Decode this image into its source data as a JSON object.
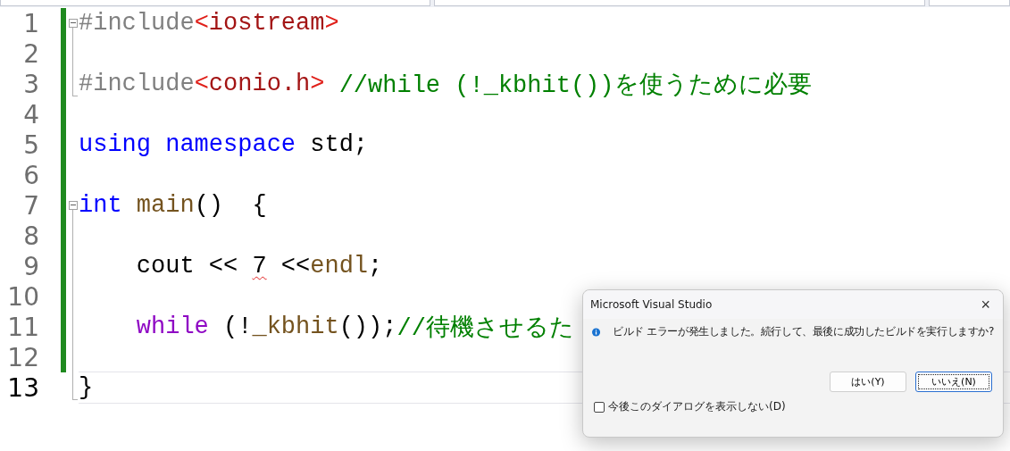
{
  "code_lines": [
    {
      "number": "1",
      "current": false,
      "changed": true,
      "kind": "foldstart",
      "tokens": [
        {
          "kind": "preproc",
          "text": "#include"
        },
        {
          "kind": "bracket",
          "text": "<"
        },
        {
          "kind": "string",
          "text": "iostream"
        },
        {
          "kind": "bracket",
          "text": ">"
        }
      ]
    },
    {
      "number": "2",
      "current": false,
      "changed": true,
      "kind": "foldline"
    },
    {
      "number": "3",
      "current": false,
      "changed": true,
      "kind": "foldend",
      "tokens": [
        {
          "kind": "preproc",
          "text": "#include"
        },
        {
          "kind": "bracket",
          "text": "<"
        },
        {
          "kind": "string",
          "text": "conio.h"
        },
        {
          "kind": "bracket",
          "text": ">"
        },
        {
          "kind": "comment",
          "text": " //while (!_kbhit())を使うために必要"
        }
      ]
    },
    {
      "number": "4",
      "current": false,
      "changed": true,
      "kind": "plain"
    },
    {
      "number": "5",
      "current": false,
      "changed": true,
      "kind": "plain",
      "tokens": [
        {
          "kind": "keyword",
          "text": "using"
        },
        {
          "kind": "keyword",
          "text": " namespace"
        },
        {
          "kind": "plain",
          "text": " std;"
        }
      ]
    },
    {
      "number": "6",
      "current": false,
      "changed": true,
      "kind": "plain"
    },
    {
      "number": "7",
      "current": false,
      "changed": true,
      "kind": "foldstart",
      "tokens": [
        {
          "kind": "keyword",
          "text": "int"
        },
        {
          "kind": "function",
          "text": " main"
        },
        {
          "kind": "plain",
          "text": "()  {"
        }
      ]
    },
    {
      "number": "8",
      "current": false,
      "changed": true,
      "kind": "foldline"
    },
    {
      "number": "9",
      "current": false,
      "changed": true,
      "kind": "foldline",
      "tokens": [
        {
          "kind": "plain",
          "text": "    cout <<"
        },
        {
          "kind": "error",
          "text": "7"
        },
        {
          "kind": "plain",
          "text": " <<"
        },
        {
          "kind": "function",
          "text": "endl"
        },
        {
          "kind": "plain",
          "text": ";"
        }
      ]
    },
    {
      "number": "10",
      "current": false,
      "changed": true,
      "kind": "foldline"
    },
    {
      "number": "11",
      "current": false,
      "changed": true,
      "kind": "foldline",
      "tokens": [
        {
          "kind": "control",
          "text": "    while"
        },
        {
          "kind": "plain",
          "text": " (!"
        },
        {
          "kind": "function",
          "text": "_kbhit"
        },
        {
          "kind": "plain",
          "text": "());"
        },
        {
          "kind": "comment",
          "text": "//待機させるた"
        }
      ]
    },
    {
      "number": "12",
      "current": false,
      "changed": true,
      "kind": "foldline"
    },
    {
      "number": "13",
      "current": true,
      "changed": false,
      "kind": "foldend",
      "tokens": [
        {
          "kind": "plain",
          "text": "}"
        }
      ]
    }
  ],
  "dialog": {
    "title": "Microsoft Visual Studio",
    "close": "×",
    "message": "ビルド エラーが発生しました。続行して、最後に成功したビルドを実行しますか?",
    "buttons": [
      {
        "label": "はい(Y)",
        "default": false
      },
      {
        "label": "いいえ(N)",
        "default": true
      }
    ],
    "checkbox": {
      "label": "今後このダイアログを表示しない(D)",
      "checked": false
    }
  }
}
